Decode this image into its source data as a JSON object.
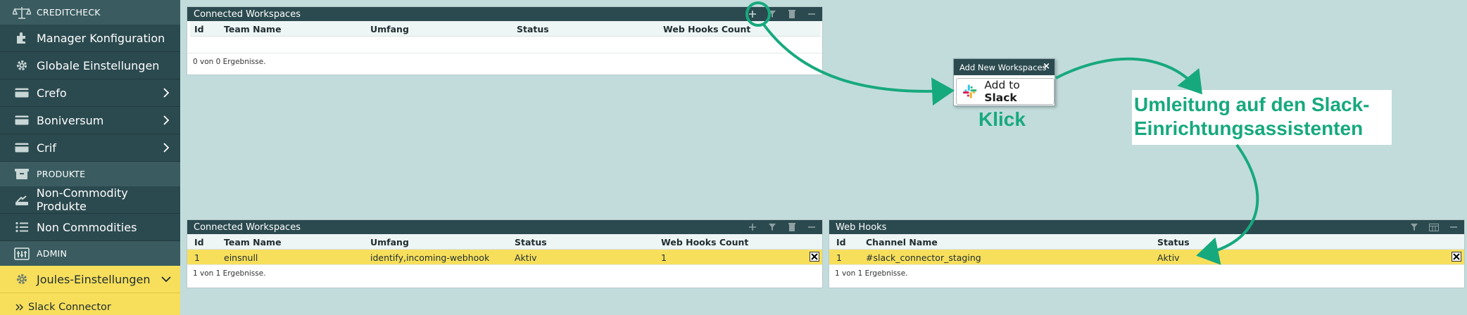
{
  "sidebar": {
    "sections": {
      "creditcheck": "CREDITCHECK",
      "produkte": "PRODUKTE",
      "admin": "ADMIN"
    },
    "items": {
      "manager_konfiguration": "Manager Konfiguration",
      "globale_einstellungen": "Globale Einstellungen",
      "crefo": "Crefo",
      "boniversum": "Boniversum",
      "crif": "Crif",
      "non_commodity_produkte": "Non-Commodity Produkte",
      "non_commodities": "Non Commodities",
      "joules_einstellungen": "Joules-Einstellungen",
      "slack_connector": "Slack Connector"
    }
  },
  "workspaces_before": {
    "title": "Connected Workspaces",
    "columns": [
      "Id",
      "Team Name",
      "Umfang",
      "Status",
      "Web Hooks Count"
    ],
    "footer": "0  von 0 Ergebnisse."
  },
  "workspaces_after": {
    "title": "Connected Workspaces",
    "columns": [
      "Id",
      "Team Name",
      "Umfang",
      "Status",
      "Web Hooks Count"
    ],
    "rows": [
      [
        "1",
        "einsnull",
        "identify,incoming-webhook",
        "Aktiv",
        "1"
      ]
    ],
    "footer": "1  von 1 Ergebnisse."
  },
  "webhooks": {
    "title": "Web Hooks",
    "columns": [
      "Id",
      "Channel Name",
      "Status"
    ],
    "rows": [
      [
        "1",
        "#slack_connector_staging",
        "Aktiv"
      ]
    ],
    "footer": "1  von 1 Ergebnisse."
  },
  "popup": {
    "title": "Add New Workspaces",
    "close": "×",
    "button_prefix": "Add to ",
    "button_brand": "Slack"
  },
  "annotations": {
    "click": "Klick",
    "redirect_line1": "Umleitung auf den Slack-",
    "redirect_line2": "Einrichtungsassistenten"
  },
  "colors": {
    "background": "#c2dcdc",
    "sidebar": "#2b4a4f",
    "highlight": "#f7df5c",
    "annotation_green": "#17a97e"
  },
  "icons": {
    "scale": "scale-icon",
    "manager": "puzzle-icon",
    "settings": "gear-icon",
    "card": "credit-card-icon",
    "chevron": "chevron-right-icon",
    "products": "box-icon",
    "list": "list-icon",
    "admin": "admin-panel-icon",
    "add": "plus-icon",
    "filter": "filter-icon",
    "trash": "trash-icon",
    "minimize": "minus-icon",
    "columns": "columns-icon",
    "remove": "close-icon",
    "slack": "slack-logo-icon"
  }
}
